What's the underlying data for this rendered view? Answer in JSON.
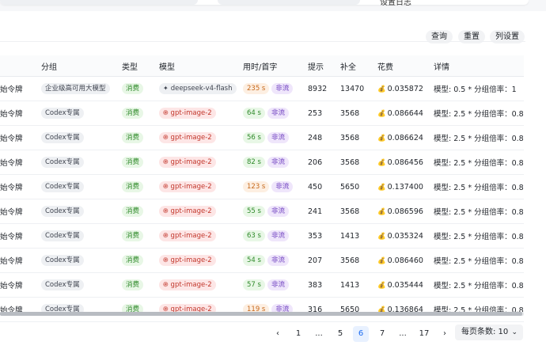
{
  "top_partial_text": "设置日志",
  "toolbar": {
    "query": "查询",
    "reset": "重置",
    "column_settings": "列设置"
  },
  "columns": {
    "token": "",
    "group": "分组",
    "type": "类型",
    "model": "模型",
    "time": "用时/首字",
    "prompt": "提示",
    "completion": "补全",
    "cost": "花费",
    "detail": "详情"
  },
  "rows": [
    {
      "token": "始令牌",
      "group": "企业级高可用大模型",
      "type": "消费",
      "model_icon": "✦",
      "model": "deepseek-v4-flash",
      "model_style": "blue",
      "time": "235 s",
      "time_style": "orange",
      "stream": "非流",
      "prompt": "8932",
      "completion": "13470",
      "cost": "0.035872",
      "detail": "模型: 0.5 * 分组倍率：1"
    },
    {
      "token": "始令牌",
      "group": "Codex专属",
      "type": "消费",
      "model_icon": "֎",
      "model": "gpt-image-2",
      "model_style": "red",
      "time": "64 s",
      "time_style": "green",
      "stream": "非流",
      "prompt": "253",
      "completion": "3568",
      "cost": "0.086644",
      "detail": "模型: 2.5 * 分组倍率：0.8"
    },
    {
      "token": "始令牌",
      "group": "Codex专属",
      "type": "消费",
      "model_icon": "֎",
      "model": "gpt-image-2",
      "model_style": "red",
      "time": "56 s",
      "time_style": "green",
      "stream": "非流",
      "prompt": "248",
      "completion": "3568",
      "cost": "0.086624",
      "detail": "模型: 2.5 * 分组倍率：0.8"
    },
    {
      "token": "始令牌",
      "group": "Codex专属",
      "type": "消费",
      "model_icon": "֎",
      "model": "gpt-image-2",
      "model_style": "red",
      "time": "82 s",
      "time_style": "green",
      "stream": "非流",
      "prompt": "206",
      "completion": "3568",
      "cost": "0.086456",
      "detail": "模型: 2.5 * 分组倍率：0.8"
    },
    {
      "token": "始令牌",
      "group": "Codex专属",
      "type": "消费",
      "model_icon": "֎",
      "model": "gpt-image-2",
      "model_style": "red",
      "time": "123 s",
      "time_style": "orange",
      "stream": "非流",
      "prompt": "450",
      "completion": "5650",
      "cost": "0.137400",
      "detail": "模型: 2.5 * 分组倍率：0.8"
    },
    {
      "token": "始令牌",
      "group": "Codex专属",
      "type": "消费",
      "model_icon": "֎",
      "model": "gpt-image-2",
      "model_style": "red",
      "time": "55 s",
      "time_style": "green",
      "stream": "非流",
      "prompt": "241",
      "completion": "3568",
      "cost": "0.086596",
      "detail": "模型: 2.5 * 分组倍率：0.8"
    },
    {
      "token": "始令牌",
      "group": "Codex专属",
      "type": "消费",
      "model_icon": "֎",
      "model": "gpt-image-2",
      "model_style": "red",
      "time": "63 s",
      "time_style": "green",
      "stream": "非流",
      "prompt": "353",
      "completion": "1413",
      "cost": "0.035324",
      "detail": "模型: 2.5 * 分组倍率：0.8"
    },
    {
      "token": "始令牌",
      "group": "Codex专属",
      "type": "消费",
      "model_icon": "֎",
      "model": "gpt-image-2",
      "model_style": "red",
      "time": "54 s",
      "time_style": "green",
      "stream": "非流",
      "prompt": "207",
      "completion": "3568",
      "cost": "0.086460",
      "detail": "模型: 2.5 * 分组倍率：0.8"
    },
    {
      "token": "始令牌",
      "group": "Codex专属",
      "type": "消费",
      "model_icon": "֎",
      "model": "gpt-image-2",
      "model_style": "red",
      "time": "57 s",
      "time_style": "green",
      "stream": "非流",
      "prompt": "383",
      "completion": "1413",
      "cost": "0.035444",
      "detail": "模型: 2.5 * 分组倍率：0.8"
    },
    {
      "token": "始令牌",
      "group": "Codex专属",
      "type": "消费",
      "model_icon": "֎",
      "model": "gpt-image-2",
      "model_style": "red",
      "time": "119 s",
      "time_style": "orange",
      "stream": "非流",
      "prompt": "316",
      "completion": "5650",
      "cost": "0.136864",
      "detail": "模型: 2.5 * 分组倍率：0.8"
    }
  ],
  "pagination": {
    "prev": "‹",
    "next": "›",
    "pages": [
      "1",
      "...",
      "5",
      "6",
      "7",
      "...",
      "17"
    ],
    "current": "6",
    "per_page_label": "每页条数: 10"
  },
  "colors": {
    "accent": "#1d6cf0",
    "consume_green": "#2f8a2a",
    "model_red": "#c2362b",
    "stream_purple": "#6e3fbf"
  }
}
